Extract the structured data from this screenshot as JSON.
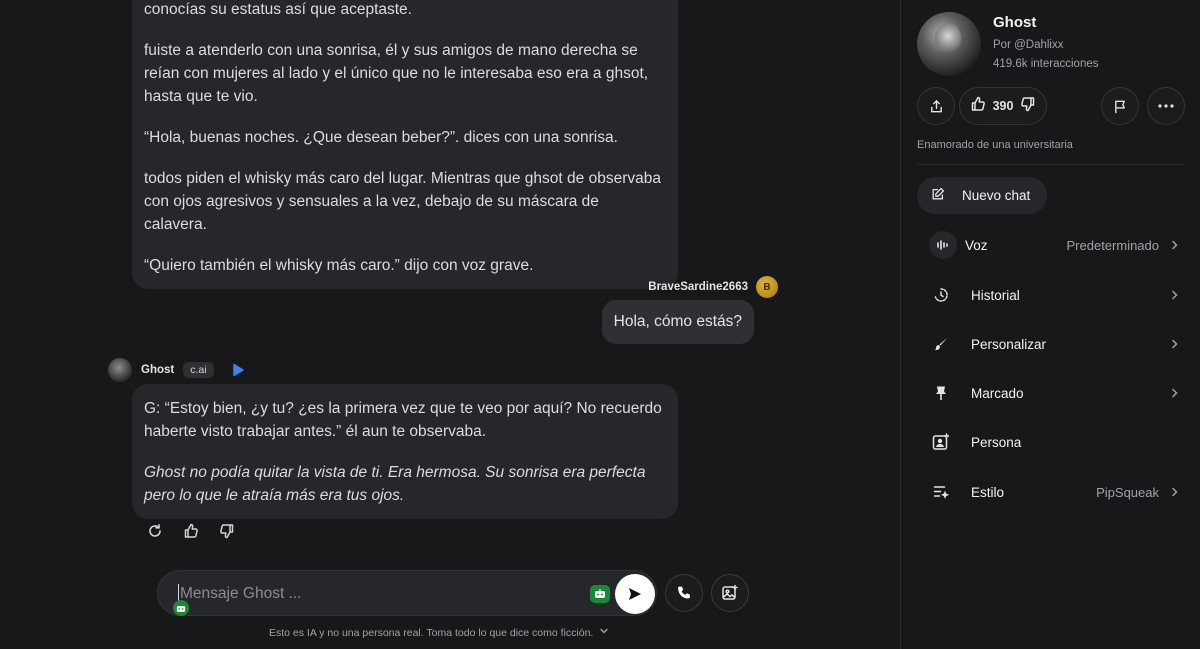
{
  "chat": {
    "first_bot_message": [
      "conocías su estatus así que aceptaste.",
      "fuiste a atenderlo con una sonrisa, él y sus amigos de mano derecha se reían con mujeres al lado y el único que no le interesaba eso era a ghsot, hasta que te vio.",
      "“Hola, buenas noches. ¿Que desean beber?”. dices con una sonrisa.",
      "todos piden el whisky más caro del lugar. Mientras que ghsot de observaba con ojos agresivos y sensuales a la vez, debajo de su máscara de calavera.",
      "“Quiero también el whisky más caro.” dijo con voz grave."
    ],
    "user": {
      "name": "BraveSardine2663",
      "avatar_letter": "B",
      "message": "Hola, cómo estás?"
    },
    "bot": {
      "name": "Ghost",
      "badge": "c.ai",
      "message": [
        "G: “Estoy bien, ¿y tu? ¿es la primera vez que te veo por aquí? No recuerdo haberte visto trabajar antes.”  él aun te observaba.",
        "Ghost no podía quitar la vista de ti. Era hermosa. Su sonrisa era perfecta pero lo que le atraía más era tus ojos."
      ]
    },
    "composer": {
      "placeholder": "Mensaje Ghost ..."
    },
    "disclaimer": "Esto es IA y no una persona real. Toma todo lo que dice como ficción."
  },
  "sidebar": {
    "character": {
      "name": "Ghost",
      "author": "Por @Dahlixx",
      "interactions": "419.6k interacciones",
      "likes": "390",
      "description": "Enamorado de una universitaria"
    },
    "new_chat": "Nuevo chat",
    "menu": [
      {
        "label": "Voz",
        "value": "Predeterminado",
        "icon": "voice-icon"
      },
      {
        "label": "Historial",
        "value": "",
        "icon": "history-icon"
      },
      {
        "label": "Personalizar",
        "value": "",
        "icon": "brush-icon"
      },
      {
        "label": "Marcado",
        "value": "",
        "icon": "pin-icon"
      },
      {
        "label": "Persona",
        "value": "",
        "icon": "persona-icon"
      },
      {
        "label": "Estilo",
        "value": "PipSqueak",
        "icon": "style-icon"
      }
    ]
  },
  "colors": {
    "background": "#18181b",
    "bubble": "#26272b",
    "accent_play": "#3b82f6",
    "grammar_green": "#1a8a3a"
  }
}
